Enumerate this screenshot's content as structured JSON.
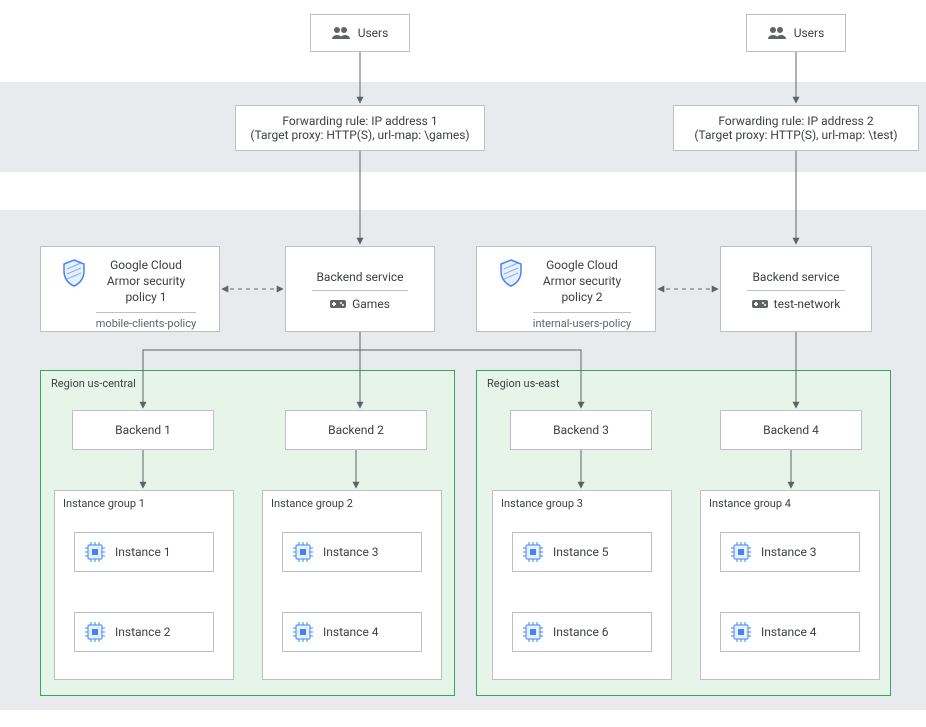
{
  "users": {
    "label": "Users"
  },
  "forwarding_rules": [
    {
      "line1": "Forwarding rule: IP address 1",
      "line2": "(Target proxy: HTTP(S), url-map: \\games)"
    },
    {
      "line1": "Forwarding rule: IP address 2",
      "line2": "(Target proxy: HTTP(S), url-map: \\test)"
    }
  ],
  "policies": [
    {
      "title_l1": "Google Cloud",
      "title_l2": "Armor security",
      "title_l3": "policy 1",
      "sub": "mobile-clients-policy"
    },
    {
      "title_l1": "Google Cloud",
      "title_l2": "Armor security",
      "title_l3": "policy 2",
      "sub": "internal-users-policy"
    }
  ],
  "backend_services": [
    {
      "title": "Backend service",
      "sub": "Games"
    },
    {
      "title": "Backend service",
      "sub": "test-network"
    }
  ],
  "regions": [
    {
      "label": "Region us-central"
    },
    {
      "label": "Region us-east"
    }
  ],
  "backends": [
    {
      "label": "Backend 1"
    },
    {
      "label": "Backend 2"
    },
    {
      "label": "Backend 3"
    },
    {
      "label": "Backend 4"
    }
  ],
  "instance_groups": [
    {
      "label": "Instance group 1",
      "instances": [
        "Instance 1",
        "Instance 2"
      ]
    },
    {
      "label": "Instance group 2",
      "instances": [
        "Instance 3",
        "Instance 4"
      ]
    },
    {
      "label": "Instance group 3",
      "instances": [
        "Instance 5",
        "Instance 6"
      ]
    },
    {
      "label": "Instance group 4",
      "instances": [
        "Instance 3",
        "Instance 4"
      ]
    }
  ]
}
